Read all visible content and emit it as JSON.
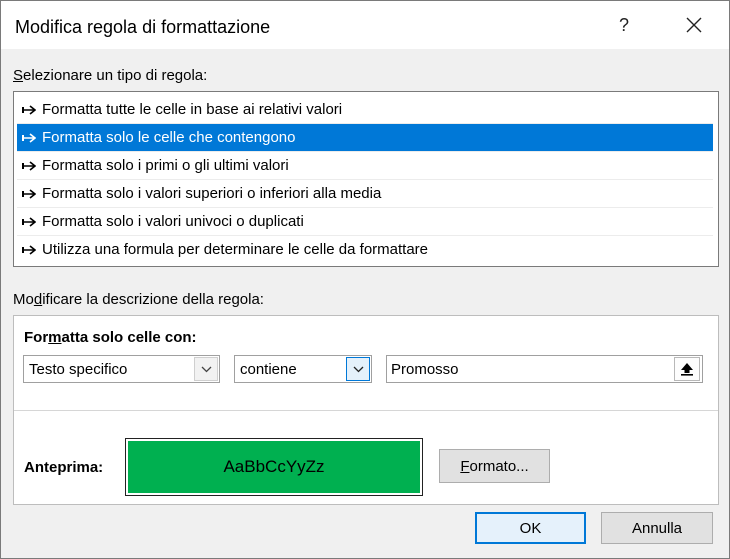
{
  "window": {
    "title": "Modifica regola di formattazione",
    "help_glyph": "?"
  },
  "rule_type": {
    "label_mnemonic": "S",
    "label_rest": "elezionare un tipo di regola:",
    "selected_index": 1,
    "items": [
      {
        "label": "Formatta tutte le celle in base ai relativi valori"
      },
      {
        "label": "Formatta solo le celle che contengono"
      },
      {
        "label": "Formatta solo i primi o gli ultimi valori"
      },
      {
        "label": "Formatta solo i valori superiori o inferiori alla media"
      },
      {
        "label": "Formatta solo i valori univoci o duplicati"
      },
      {
        "label": "Utilizza una formula per determinare le celle da formattare"
      }
    ]
  },
  "rule_description": {
    "label_pre": "Mo",
    "label_mnemonic": "d",
    "label_post": "ificare la descrizione della regola:",
    "format_only_pre": "For",
    "format_only_mnemonic": "m",
    "format_only_post": "atta solo celle con:",
    "condition_type": "Testo specifico",
    "operator": "contiene",
    "value": "Promosso",
    "preview_label": "Anteprima:",
    "preview_text": "AaBbCcYyZz",
    "preview_fill_color": "#00B050",
    "format_button_mnemonic": "F",
    "format_button_rest": "ormato..."
  },
  "buttons": {
    "ok": "OK",
    "cancel": "Annulla"
  },
  "icons": {
    "help": "help-icon",
    "close": "close-icon",
    "rule_arrow": "arrow-right-icon",
    "dropdown": "chevron-down-icon",
    "collapse": "collapse-dialog-icon"
  }
}
